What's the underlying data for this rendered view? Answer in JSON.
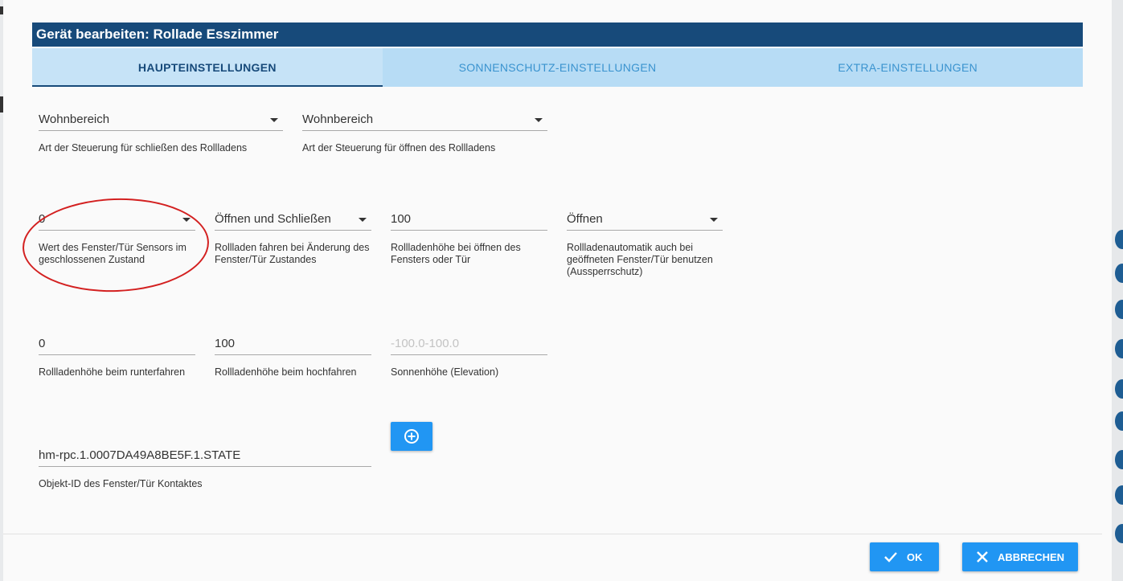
{
  "dialog": {
    "title": "Gerät bearbeiten: Rollade Esszimmer"
  },
  "tabs": [
    {
      "label": "HAUPTEINSTELLUNGEN",
      "active": true
    },
    {
      "label": "SONNENSCHUTZ-EINSTELLUNGEN",
      "active": false
    },
    {
      "label": "EXTRA-EINSTELLUNGEN",
      "active": false
    }
  ],
  "fields": {
    "close_control": {
      "value": "Wohnbereich",
      "help": "Art der Steuerung für schließen des Rollladens"
    },
    "open_control": {
      "value": "Wohnbereich",
      "help": "Art der Steuerung für öffnen des Rollladens"
    },
    "sensor_closed_value": {
      "value": "0",
      "help": "Wert des Fenster/Tür Sensors im geschlossenen Zustand"
    },
    "move_on_change": {
      "value": "Öffnen und Schließen",
      "help": "Rollladen fahren bei Änderung des Fenster/Tür Zustandes"
    },
    "height_on_open": {
      "value": "100",
      "help": "Rollladenhöhe bei öffnen des Fensters oder Tür"
    },
    "lockout_protection": {
      "value": "Öffnen",
      "help": "Rollladenautomatik auch bei geöffneten Fenster/Tür benutzen (Aussperrschutz)"
    },
    "height_down": {
      "value": "0",
      "help": "Rollladenhöhe beim runterfahren"
    },
    "height_up": {
      "value": "100",
      "help": "Rollladenhöhe beim hochfahren"
    },
    "elevation": {
      "placeholder": "-100.0-100.0",
      "help": "Sonnenhöhe (Elevation)"
    },
    "contact_object_id": {
      "value": "hm-rpc.1.0007DA49A8BE5F.1.STATE",
      "help": "Objekt-ID des Fenster/Tür Kontaktes"
    }
  },
  "buttons": {
    "add_icon": "plus-circle-icon",
    "ok_label": "OK",
    "ok_icon": "check-icon",
    "cancel_label": "ABBRECHEN",
    "cancel_icon": "close-icon"
  },
  "colors": {
    "title_bar": "#174a7a",
    "tabs_bg": "#b7dcf5",
    "primary_button": "#2196f3",
    "annotation_circle": "#d32020"
  }
}
